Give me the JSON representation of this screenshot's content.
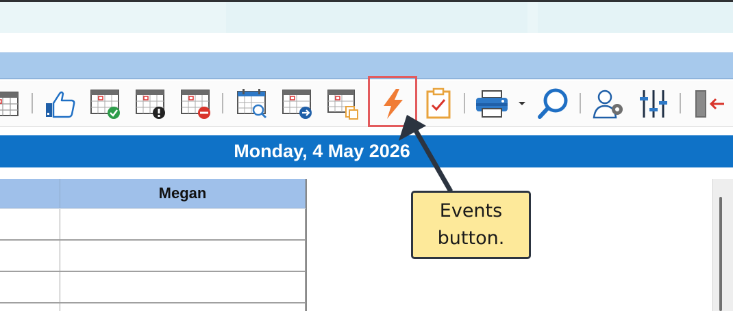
{
  "toolbar": {
    "buttons": [
      {
        "icon": "calendar-icon"
      },
      {
        "icon": "thumbs-up-icon"
      },
      {
        "icon": "calendar-check-icon"
      },
      {
        "icon": "calendar-alert-icon"
      },
      {
        "icon": "calendar-remove-icon"
      },
      {
        "icon": "calendar-search-icon"
      },
      {
        "icon": "calendar-forward-icon"
      },
      {
        "icon": "calendar-copy-icon"
      },
      {
        "icon": "lightning-bolt-icon"
      },
      {
        "icon": "clipboard-check-icon"
      },
      {
        "icon": "printer-icon"
      },
      {
        "icon": "magnifier-icon"
      },
      {
        "icon": "user-settings-icon"
      },
      {
        "icon": "sliders-icon"
      },
      {
        "icon": "exit-door-icon"
      }
    ]
  },
  "date_header": {
    "text": "Monday, 4 May 2026"
  },
  "grid": {
    "columns": [
      "",
      "Megan"
    ]
  },
  "callout": {
    "line1": "Events",
    "line2": "button."
  },
  "colors": {
    "toolbar_highlight": "#e35b5d",
    "date_bar": "#0f72c7",
    "callout_bg": "#fde99a",
    "header_bg": "#9fc0ea"
  }
}
